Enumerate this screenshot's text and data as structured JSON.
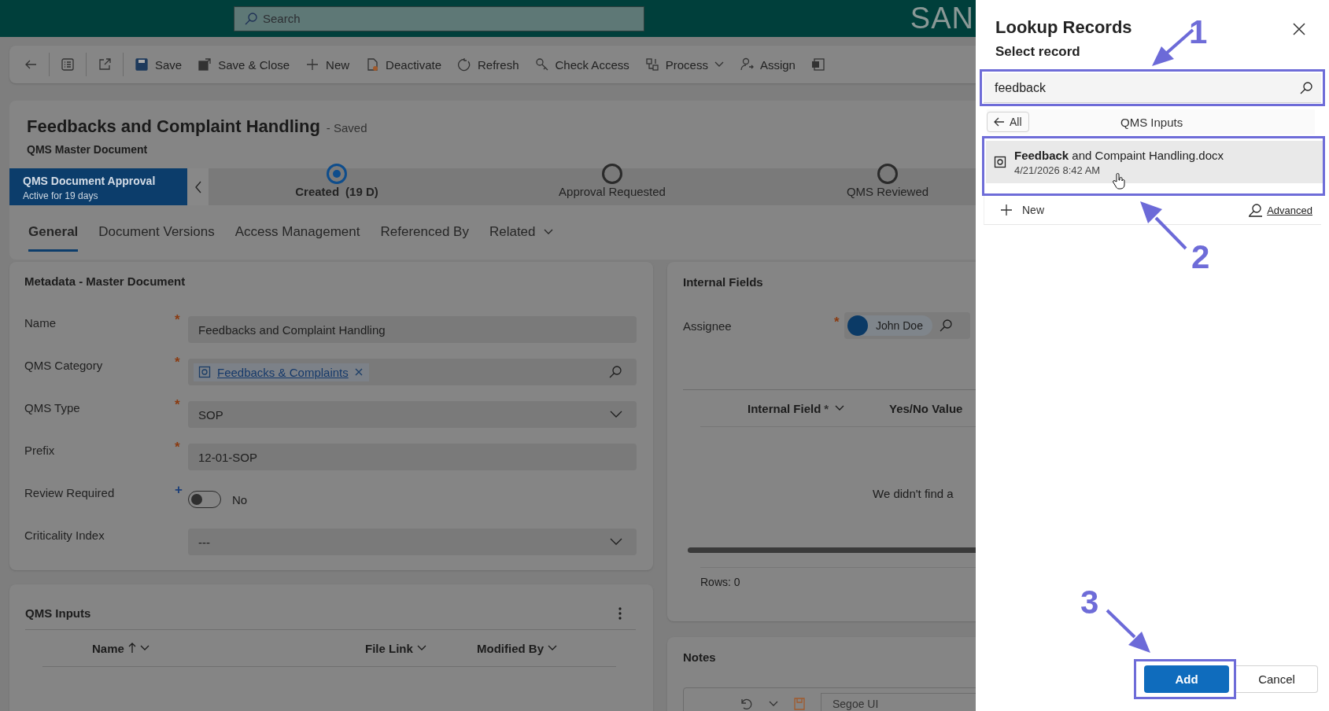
{
  "top_bar": {
    "search_placeholder": "Search",
    "brand": "SAN"
  },
  "toolbar": [
    {
      "kind": "icon",
      "divider_after": true
    },
    {
      "kind": "icon",
      "divider_after": true
    },
    {
      "kind": "icon",
      "divider_after": true
    },
    {
      "kind": "labeled",
      "label": "Save"
    },
    {
      "kind": "labeled",
      "label": "Save & Close"
    },
    {
      "kind": "labeled",
      "label": "New"
    },
    {
      "kind": "labeled",
      "label": "Deactivate"
    },
    {
      "kind": "labeled",
      "label": "Refresh"
    },
    {
      "kind": "labeled",
      "label": "Check Access"
    },
    {
      "kind": "menu",
      "label": "Process"
    },
    {
      "kind": "labeled",
      "label": "Assign"
    },
    {
      "kind": "icon"
    }
  ],
  "header": {
    "title": "Feedbacks and Complaint Handling",
    "status": "- Saved",
    "subtitle": "QMS Master Document"
  },
  "process": {
    "name": "QMS Document Approval",
    "duration": "Active for 19 days",
    "stages": [
      {
        "label": "Created",
        "duration": "(19 D)",
        "selected": true
      },
      {
        "label": "Approval Requested",
        "selected": false
      },
      {
        "label": "QMS Reviewed",
        "selected": false
      }
    ]
  },
  "tabs": [
    {
      "label": "General",
      "selected": true
    },
    {
      "label": "Document Versions",
      "selected": false
    },
    {
      "label": "Access Management",
      "selected": false
    },
    {
      "label": "Referenced By",
      "selected": false
    },
    {
      "label": "Related",
      "selected": false,
      "kind": "menu"
    }
  ],
  "metadata": {
    "title": "Metadata - Master Document",
    "fields": [
      {
        "label": "Name",
        "marker": "*",
        "color": "#8a3a10",
        "kind": "text",
        "value": "Feedbacks and Complaint Handling"
      },
      {
        "label": "QMS Category",
        "marker": "*",
        "color": "#8a3a10",
        "kind": "lookup",
        "value": "Feedbacks & Complaints"
      },
      {
        "label": "QMS Type",
        "marker": "*",
        "color": "#8a3a10",
        "kind": "select",
        "value": "SOP"
      },
      {
        "label": "Prefix",
        "marker": "*",
        "color": "#8a3a10",
        "kind": "text",
        "value": "12-01-SOP"
      },
      {
        "label": "Review Required",
        "marker": "+",
        "color": "#1d3f78",
        "kind": "toggle",
        "on": false,
        "value": "No"
      },
      {
        "label": "Criticality Index",
        "kind": "select",
        "value": "---"
      }
    ]
  },
  "qms_inputs": {
    "title": "QMS Inputs",
    "columns": [
      {
        "label": "Name",
        "sorted": true
      },
      {
        "label": "File Link"
      },
      {
        "label": "Modified By"
      }
    ]
  },
  "internal_fields": {
    "title": "Internal Fields",
    "assignee": {
      "label": "Assignee",
      "marker": "*",
      "value": "John Doe"
    },
    "columns": [
      {
        "label": "Internal Field",
        "marker": "*"
      },
      {
        "label": "Yes/No Value"
      }
    ],
    "empty_message": "We didn't find a",
    "rows": "Rows: 0"
  },
  "notes": {
    "title": "Notes",
    "font": "Segoe UI"
  },
  "lookup_panel": {
    "title": "Lookup Records",
    "subtitle": "Select record",
    "search_value": "feedback",
    "back_label": "All",
    "group": "QMS Inputs",
    "results": [
      {
        "title": "**Feedback** and Compaint Handling.docx",
        "date": "4/21/2026 8:42 AM",
        "selected": true
      }
    ],
    "new_label": "New",
    "advanced_label": "Advanced",
    "primary": "Add",
    "secondary": "Cancel"
  },
  "annotations": [
    {
      "number": "1"
    },
    {
      "number": "2"
    },
    {
      "number": "3"
    }
  ]
}
